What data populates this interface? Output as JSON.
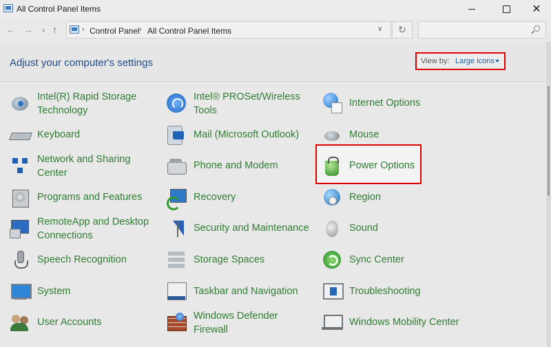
{
  "window": {
    "title": "All Control Panel Items",
    "close_glyph": "✕"
  },
  "nav": {
    "back_glyph": "←",
    "forward_glyph": "→",
    "recent_glyph": "∨",
    "up_glyph": "↑",
    "breadcrumb": [
      "Control Panel",
      "All Control Panel Items"
    ],
    "breadcrumb_sep": "›",
    "dropdown_glyph": "∨",
    "refresh_glyph": "↻",
    "search_placeholder": ""
  },
  "header": {
    "title": "Adjust your computer's settings",
    "view_by_label": "View by:",
    "view_by_value": "Large icons"
  },
  "colors": {
    "item_text": "#2f7d32",
    "heading": "#1f4a86",
    "link": "#1a5fa8",
    "highlight_border": "#e00000"
  },
  "items": {
    "col1": [
      {
        "label": "Intel(R) Rapid Storage Technology",
        "line1": "Intel(R) Rapid Storage",
        "line2": "Technology",
        "icon": "disk-icon"
      },
      {
        "label": "Keyboard",
        "icon": "keyboard-icon"
      },
      {
        "label": "Network and Sharing Center",
        "line1": "Network and Sharing",
        "line2": "Center",
        "icon": "network-icon"
      },
      {
        "label": "Programs and Features",
        "icon": "programs-icon"
      },
      {
        "label": "RemoteApp and Desktop Connections",
        "line1": "RemoteApp and Desktop",
        "line2": "Connections",
        "icon": "remote-desktop-icon"
      },
      {
        "label": "Speech Recognition",
        "icon": "microphone-icon"
      },
      {
        "label": "System",
        "icon": "monitor-icon"
      },
      {
        "label": "User Accounts",
        "icon": "users-icon"
      }
    ],
    "col2": [
      {
        "label": "Intel® PROSet/Wireless Tools",
        "line1": "Intel® PROSet/Wireless",
        "line2": "Tools",
        "icon": "wifi-icon"
      },
      {
        "label": "Mail (Microsoft Outlook)",
        "icon": "mail-icon"
      },
      {
        "label": "Phone and Modem",
        "icon": "phone-icon"
      },
      {
        "label": "Recovery",
        "icon": "recovery-icon"
      },
      {
        "label": "Security and Maintenance",
        "icon": "flag-icon"
      },
      {
        "label": "Storage Spaces",
        "icon": "storage-icon"
      },
      {
        "label": "Taskbar and Navigation",
        "icon": "taskbar-icon"
      },
      {
        "label": "Windows Defender Firewall",
        "line1": "Windows Defender",
        "line2": "Firewall",
        "icon": "firewall-icon"
      }
    ],
    "col3": [
      {
        "label": "Internet Options",
        "icon": "globe-icon"
      },
      {
        "label": "Mouse",
        "icon": "mouse-icon"
      },
      {
        "label": "Power Options",
        "icon": "power-icon",
        "highlighted": true
      },
      {
        "label": "Region",
        "icon": "region-globe-icon"
      },
      {
        "label": "Sound",
        "icon": "speaker-icon"
      },
      {
        "label": "Sync Center",
        "icon": "sync-icon"
      },
      {
        "label": "Troubleshooting",
        "icon": "troubleshoot-icon"
      },
      {
        "label": "Windows Mobility Center",
        "icon": "laptop-icon"
      }
    ]
  }
}
